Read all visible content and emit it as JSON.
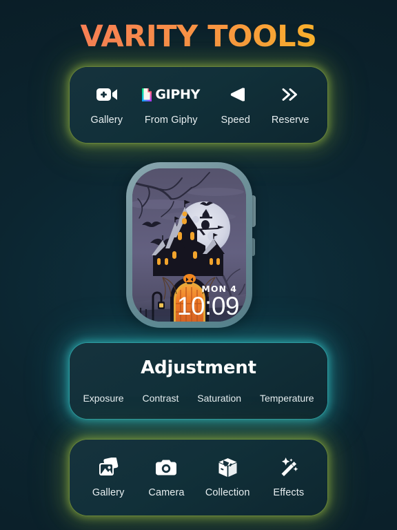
{
  "header": {
    "title": "VARITY TOOLS",
    "gradient_start": "#f5735c",
    "gradient_end": "#fcc81f"
  },
  "theme": {
    "background": "#0c2530",
    "card_background": "#12323d",
    "glow_lime": "#9aba3f",
    "glow_cyan": "#3cd6d8",
    "text": "#e8eff1"
  },
  "tools_card": {
    "glow": "#9aba3f",
    "items": [
      {
        "label": "Gallery",
        "icon": "video-camera-plus-icon"
      },
      {
        "label": "From Giphy",
        "icon": "giphy-logo-icon",
        "wordmark": "GIPHY"
      },
      {
        "label": "Speed",
        "icon": "play-left-triangle-icon"
      },
      {
        "label": "Reserve",
        "icon": "double-chevron-right-icon"
      }
    ]
  },
  "watch": {
    "face_name": "halloween-haunted-house",
    "date": "MON 4",
    "time": "10:09"
  },
  "adjustment_card": {
    "glow": "#3cd6d8",
    "title": "Adjustment",
    "options": [
      {
        "label": "Exposure"
      },
      {
        "label": "Contrast"
      },
      {
        "label": "Saturation"
      },
      {
        "label": "Temperature"
      }
    ]
  },
  "sources_card": {
    "glow": "#9aba3f",
    "items": [
      {
        "label": "Gallery",
        "icon": "photos-stack-icon"
      },
      {
        "label": "Camera",
        "icon": "camera-icon"
      },
      {
        "label": "Collection",
        "icon": "box-package-icon"
      },
      {
        "label": "Effects",
        "icon": "magic-wand-sparkles-icon"
      }
    ]
  }
}
